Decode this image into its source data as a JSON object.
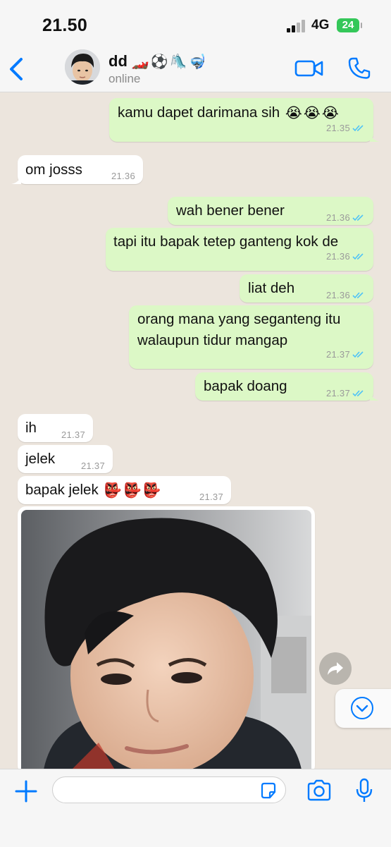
{
  "status_bar": {
    "time": "21.50",
    "network": "4G",
    "battery": "24"
  },
  "header": {
    "contact_name": "dd",
    "name_emojis": [
      "🏎️",
      "⚽",
      "🛝",
      "🤿"
    ],
    "status": "online"
  },
  "messages": [
    {
      "dir": "out",
      "text": "kamu dapet darimana sih",
      "emojis": [
        "😭",
        "😭",
        "😭"
      ],
      "time": "21.35",
      "read": true
    },
    {
      "dir": "in",
      "text": "om josss",
      "time": "21.36"
    },
    {
      "dir": "out",
      "text": "wah bener bener",
      "time": "21.36",
      "read": true
    },
    {
      "dir": "out",
      "text": "tapi itu bapak tetep ganteng kok de",
      "time": "21.36",
      "read": true
    },
    {
      "dir": "out",
      "text": "liat deh",
      "time": "21.36",
      "read": true
    },
    {
      "dir": "out",
      "text_lines": [
        "orang mana yang seganteng itu",
        "walaupun tidur mangap"
      ],
      "time": "21.37",
      "read": true
    },
    {
      "dir": "out",
      "text": "bapak doang",
      "time": "21.37",
      "read": true
    },
    {
      "dir": "in",
      "text": "ih",
      "time": "21.37"
    },
    {
      "dir": "in",
      "text": "jelek",
      "time": "21.37"
    },
    {
      "dir": "in",
      "text": "bapak jelek",
      "emojis": [
        "👺",
        "👺",
        "👺"
      ],
      "time": "21.37"
    }
  ],
  "composer": {
    "placeholder": "",
    "value": ""
  },
  "colors": {
    "accent": "#007aff",
    "outgoing_bubble": "#dcf8c6",
    "incoming_bubble": "#ffffff",
    "chat_bg": "#ece5dd",
    "read_ticks": "#4fc3f7"
  }
}
